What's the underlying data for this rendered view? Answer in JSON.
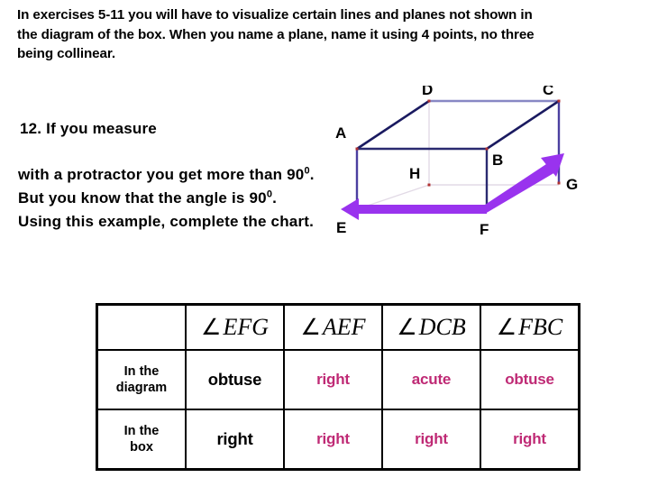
{
  "intro": {
    "text": "In exercises 5-11 you will have to visualize certain lines and planes not shown in the diagram of the box.  When you name a plane, name it using 4 points, no three being collinear."
  },
  "question": {
    "number_line": "12.  If you measure",
    "body_part1": " with a protractor you get more than 90",
    "body_sup1": "0",
    "body_part2": ".  But you know that the angle is 90",
    "body_sup2": "0",
    "body_part3": ". Using this example, complete the chart."
  },
  "diagram": {
    "name": "rectangular-box-3d",
    "vertex_labels": {
      "A": "A",
      "B": "B",
      "C": "C",
      "D": "D",
      "E": "E",
      "F": "F",
      "G": "G",
      "H": "H"
    },
    "arrow": {
      "name": "double-headed-arrow-EG",
      "color": "#9933EE"
    },
    "edge_color_front": "#4B3FA0",
    "edge_color_diagonal": "#1A1A60",
    "edge_color_back": "#8888C4",
    "hidden_edge_color": "#E0D8E0"
  },
  "chart_data": {
    "type": "table",
    "title": "",
    "columns": [
      "",
      "∠ EFG",
      "∠ AEF",
      "∠ DCB",
      "∠ FBC"
    ],
    "angle_symbol": "∠",
    "angle_names": [
      "EFG",
      "AEF",
      "DCB",
      "FBC"
    ],
    "rows": [
      {
        "label_line1": "In the",
        "label_line2": "diagram",
        "values": [
          "obtuse",
          "right",
          "acute",
          "obtuse"
        ],
        "value_colors": [
          "#000000",
          "#BF2A75",
          "#BF2A75",
          "#BF2A75"
        ]
      },
      {
        "label_line1": "In the",
        "label_line2": "box",
        "values": [
          "right",
          "right",
          "right",
          "right"
        ],
        "value_colors": [
          "#000000",
          "#BF2A75",
          "#BF2A75",
          "#BF2A75"
        ]
      }
    ]
  },
  "colors": {
    "magenta": "#BF2A75",
    "purple_arrow": "#9933EE",
    "navy_edge": "#1A1A60"
  }
}
